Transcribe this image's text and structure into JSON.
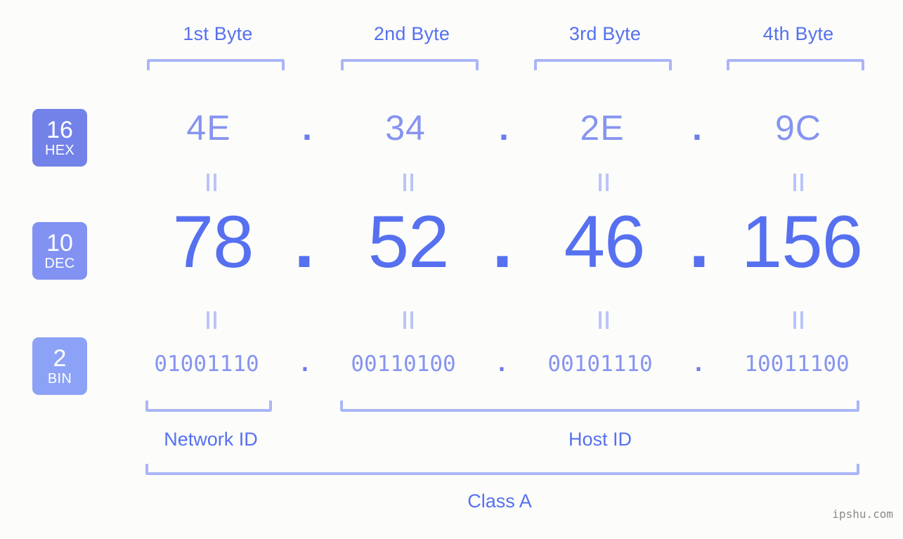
{
  "background_color": "#fcfdfa",
  "accent_color": "#5670f0",
  "bracket_color": "#aab5f7",
  "eq_color": "#b9c4f9",
  "header": {
    "byte_labels": [
      "1st Byte",
      "2nd Byte",
      "3rd Byte",
      "4th Byte"
    ]
  },
  "badges": [
    {
      "num": "16",
      "name": "HEX",
      "color": "#7382e8"
    },
    {
      "num": "10",
      "name": "DEC",
      "color": "#8192f2"
    },
    {
      "num": "2",
      "name": "BIN",
      "color": "#8ca2f6"
    }
  ],
  "separator": ".",
  "equals_mark": "=",
  "rows": {
    "hex": {
      "label": "HEX",
      "base": "16",
      "values": [
        "4E",
        "34",
        "2E",
        "9C"
      ],
      "color": "#8694f0"
    },
    "dec": {
      "label": "DEC",
      "base": "10",
      "values": [
        "78",
        "52",
        "46",
        "156"
      ],
      "color": "#5670f0"
    },
    "bin": {
      "label": "BIN",
      "base": "2",
      "values": [
        "01001110",
        "00110100",
        "00101110",
        "10011100"
      ],
      "color": "#8694f0"
    }
  },
  "footer": {
    "network_id_label": "Network ID",
    "host_id_label": "Host ID",
    "class_label": "Class A"
  },
  "watermark": "ipshu.com",
  "chart_data": {
    "type": "table",
    "title": "IP address 78.52.46.156 byte breakdown",
    "categories": [
      "1st Byte",
      "2nd Byte",
      "3rd Byte",
      "4th Byte"
    ],
    "series": [
      {
        "name": "HEX",
        "values": [
          "4E",
          "34",
          "2E",
          "9C"
        ]
      },
      {
        "name": "DEC",
        "values": [
          "78",
          "52",
          "46",
          "156"
        ]
      },
      {
        "name": "BIN",
        "values": [
          "01001110",
          "00110100",
          "00101110",
          "10011100"
        ]
      }
    ],
    "annotations": {
      "network_id_bytes": [
        "1st Byte"
      ],
      "host_id_bytes": [
        "2nd Byte",
        "3rd Byte",
        "4th Byte"
      ],
      "class": "Class A"
    }
  }
}
